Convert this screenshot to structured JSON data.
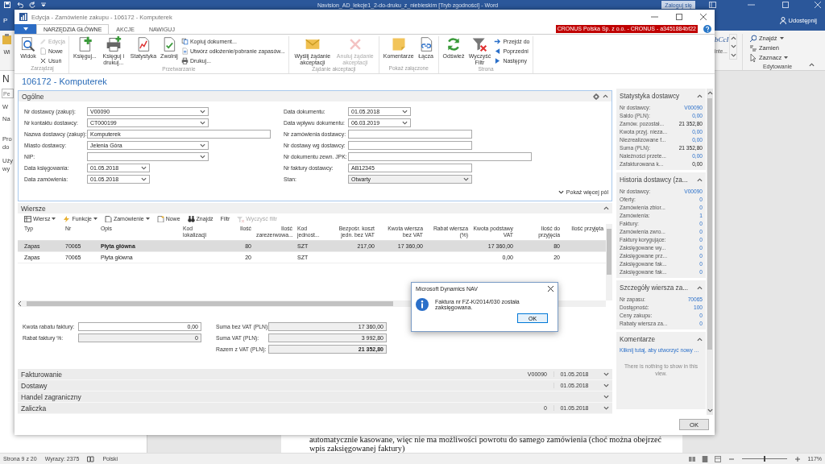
{
  "word": {
    "title": "Navision_AD_lekcje1_2-do-druku_z_niebieskim [Tryb zgodności] - Word",
    "sign_in": "Zaloguj się",
    "tab_fragment": "P",
    "share": "Udostępnij",
    "ribbon_fragment": "Wi",
    "gallery_fragments": [
      "bCcI",
      "inte..."
    ],
    "editing": {
      "items": [
        {
          "label": "Znajdź",
          "menu": true
        },
        {
          "label": "Zamień",
          "menu": false
        },
        {
          "label": "Zaznacz",
          "menu": true
        }
      ],
      "label": "Edytowanie"
    },
    "nav_pane": [
      {
        "kind": "heading",
        "text": "N"
      },
      {
        "kind": "search",
        "placeholder": "Pe"
      },
      {
        "kind": "tab",
        "text": "W"
      },
      {
        "kind": "tab",
        "text": "Na"
      },
      {
        "kind": "text",
        "text": "Pro"
      },
      {
        "kind": "text",
        "text": "do"
      },
      {
        "kind": "gap_text",
        "text": "Uży"
      },
      {
        "kind": "text",
        "text": "wy"
      }
    ],
    "document_lines": [
      "automatycznie kasowane, więc nie ma możliwości powrotu do samego zamówienia (choć można obejrzeć",
      "wpis zaksięgowanej faktury)"
    ],
    "status_bar": {
      "items": [
        "Strona 9 z 20",
        "Wyrazy: 2375",
        "Polski"
      ],
      "zoom": {
        "level": 0.5,
        "reading": "117%"
      }
    }
  },
  "nav": {
    "title": "Edycja - Zamówienie zakupu - 106172 - Komputerek",
    "tabs": [
      {
        "label": "NARZĘDZIA GŁÓWNE",
        "selected": true
      },
      {
        "label": "AKCJE",
        "selected": false
      },
      {
        "label": "NAWIGUJ",
        "selected": false
      }
    ],
    "company": "CRONUS Polska Sp. z o.o. - CRONUS - a3451884bf22",
    "ribbon": [
      {
        "label": "Zarządzaj",
        "buttons": [
          {
            "label": "Widok",
            "kind": "large",
            "disabled": false
          },
          {
            "label": "Edycja",
            "kind": "small",
            "disabled": true
          },
          {
            "label": "Nowe",
            "kind": "small",
            "disabled": false
          },
          {
            "label": "Usuń",
            "kind": "small",
            "disabled": false
          }
        ]
      },
      {
        "label": "Przetwarzanie",
        "buttons": [
          {
            "label": "Księguj...",
            "kind": "large",
            "disabled": false
          },
          {
            "label": "Księguj i drukuj...",
            "kind": "large",
            "disabled": false
          },
          {
            "label": "Statystyka",
            "kind": "large",
            "disabled": false
          },
          {
            "label": "Zwolnij",
            "kind": "large",
            "disabled": false
          },
          {
            "label": "Kopiuj dokument...",
            "kind": "small",
            "disabled": false
          },
          {
            "label": "Utwórz odłożenie/pobranie zapasów...",
            "kind": "small",
            "disabled": false
          },
          {
            "label": "Drukuj...",
            "kind": "small",
            "disabled": false
          }
        ]
      },
      {
        "label": "Żądanie akceptacji",
        "buttons": [
          {
            "label": "Wyślij żądanie akceptacji",
            "kind": "large",
            "disabled": false
          },
          {
            "label": "Anuluj żądanie akceptacji",
            "kind": "large",
            "disabled": true
          }
        ]
      },
      {
        "label": "Pokaż załączone",
        "buttons": [
          {
            "label": "Komentarze",
            "kind": "large",
            "disabled": false
          },
          {
            "label": "Łącza",
            "kind": "large",
            "disabled": false
          }
        ]
      },
      {
        "label": "Strona",
        "buttons": [
          {
            "label": "Odśwież",
            "kind": "large",
            "disabled": false
          },
          {
            "label": "Wyczyść Filtr",
            "kind": "large",
            "disabled": false
          },
          {
            "label": "Przejdź do",
            "kind": "small",
            "disabled": false
          },
          {
            "label": "Poprzedni",
            "kind": "small",
            "disabled": false
          },
          {
            "label": "Następny",
            "kind": "small",
            "disabled": false
          }
        ]
      }
    ],
    "page_title": "106172 - Komputerek",
    "general": {
      "title": "Ogólne",
      "left": [
        {
          "label": "Nr dostawcy (zakup):",
          "value": "V00090",
          "kind": "dropdown"
        },
        {
          "label": "Nr kontaktu dostawcy:",
          "value": "CT000199",
          "kind": "dropdown"
        },
        {
          "label": "Nazwa dostawcy (zakup):",
          "value": "Komputerek",
          "kind": "wide_text"
        },
        {
          "label": "Miasto dostawcy:",
          "value": "Jelenia Góra",
          "kind": "dropdown"
        },
        {
          "label": "NIP:",
          "kind": "dropdown"
        },
        {
          "label": "Data księgowania:",
          "value": "01.05.2018",
          "kind": "date"
        },
        {
          "label": "Data zamówienia:",
          "value": "01.05.2018",
          "kind": "date"
        }
      ],
      "right": [
        {
          "label": "Data dokumentu:",
          "value": "01.05.2018",
          "kind": "date"
        },
        {
          "label": "Data wpływu dokumentu:",
          "value": "06.03.2019",
          "kind": "date"
        },
        {
          "label": "Nr zamówienia dostawcy:",
          "kind": "text"
        },
        {
          "label": "Nr dostawy wg dostawcy:",
          "kind": "text"
        },
        {
          "label": "Nr dokumentu zewn. JPK:",
          "kind": "wide_text"
        },
        {
          "label": "Nr faktury dostawcy:",
          "value": "AB12345",
          "kind": "text"
        },
        {
          "label": "Stan:",
          "value": "Otwarty",
          "kind": "readonly_dropdown"
        }
      ],
      "more": "Pokaż więcej pól"
    },
    "lines": {
      "title": "Wiersze",
      "toolbar": [
        {
          "label": "Wiersz",
          "menu": true,
          "disabled": false
        },
        {
          "label": "Funkcje",
          "menu": true,
          "disabled": false
        },
        {
          "label": "Zamówienie",
          "menu": true,
          "disabled": false
        },
        {
          "label": "Nowe",
          "menu": false,
          "disabled": false
        },
        {
          "label": "Znajdź",
          "menu": false,
          "disabled": false
        },
        {
          "label": "Filtr",
          "menu": false,
          "disabled": false
        },
        {
          "label": "Wyczyść filtr",
          "menu": false,
          "disabled": true
        }
      ],
      "columns": [
        "Typ",
        "Nr",
        "Opis",
        "Kod lokalizacji",
        "Ilość",
        "Ilość zarezerwowa...",
        "Kod jednost...",
        "Bezpośr. koszt jedn. bez VAT",
        "Kwota wiersza bez VAT",
        "Rabat wiersza (%)",
        "Kwota podstawy VAT",
        "Ilość do przyjęcia",
        "Ilość przyjęta"
      ],
      "rows": [
        {
          "selected": true,
          "cells": [
            "Zapas",
            "70065",
            "Płyta główna",
            null,
            "80",
            null,
            "SZT",
            "217,00",
            "17 360,00",
            null,
            "17 360,00",
            "80",
            null
          ]
        },
        {
          "selected": false,
          "cells": [
            "Zapas",
            "70065",
            "Płyta główna",
            null,
            "20",
            null,
            "SZT",
            null,
            null,
            null,
            "0,00",
            "20",
            null
          ]
        }
      ]
    },
    "totals": {
      "left": [
        {
          "label": "Kwota rabatu faktury:",
          "value": "0,00",
          "editable": true
        },
        {
          "label": "Rabat faktury %:",
          "value": "0",
          "editable": false
        }
      ],
      "right": [
        {
          "label": "Suma bez VAT (PLN):",
          "value": "17 360,00"
        },
        {
          "label": "Suma VAT (PLN):",
          "value": "3 992,80"
        },
        {
          "label": "Razem z VAT (PLN):",
          "value": "21 352,80"
        }
      ]
    },
    "fasttabs": [
      {
        "title": "Fakturowanie",
        "summary": "V00090",
        "date": "01.05.2018"
      },
      {
        "title": "Dostawy",
        "date": "01.05.2018"
      },
      {
        "title": "Handel zagraniczny"
      },
      {
        "title": "Zaliczka",
        "summary": "0",
        "date": "01.05.2018"
      }
    ],
    "factbox": [
      {
        "title": "Statystyka dostawcy",
        "rows": [
          {
            "label": "Nr dostawcy:",
            "value": "V00090",
            "link": true
          },
          {
            "label": "Saldo (PLN):",
            "value": "0,00",
            "link": true
          },
          {
            "label": "Zamów. pozostał...",
            "value": "21 352,80",
            "link": false
          },
          {
            "label": "Kwota przyj. nieza...",
            "value": "0,00",
            "link": true
          },
          {
            "label": "Niezrealizowane f...",
            "value": "0,00",
            "link": true
          },
          {
            "label": "Suma (PLN):",
            "value": "21 352,80",
            "link": false
          },
          {
            "label": "Należności przete...",
            "value": "0,00",
            "link": true
          },
          {
            "label": "Zafakturowana k...",
            "value": "0,00",
            "link": false
          }
        ]
      },
      {
        "title": "Historia dostawcy (za...",
        "rows": [
          {
            "label": "Nr dostawcy:",
            "value": "V00090",
            "link": true
          },
          {
            "label": "Oferty:",
            "value": "0",
            "link": true
          },
          {
            "label": "Zamówienia zbior...",
            "value": "0",
            "link": true
          },
          {
            "label": "Zamówienia:",
            "value": "1",
            "link": true
          },
          {
            "label": "Faktury:",
            "value": "0",
            "link": true
          },
          {
            "label": "Zamówienia zwro...",
            "value": "0",
            "link": true
          },
          {
            "label": "Faktury korygujące:",
            "value": "0",
            "link": true
          },
          {
            "label": "Zaksięgowane wy...",
            "value": "0",
            "link": true
          },
          {
            "label": "Zaksięgowane prz...",
            "value": "0",
            "link": true
          },
          {
            "label": "Zaksięgowane fak...",
            "value": "0",
            "link": true
          },
          {
            "label": "Zaksięgowane fak...",
            "value": "0",
            "link": true
          }
        ]
      },
      {
        "title": "Szczegóły wiersza za...",
        "rows": [
          {
            "label": "Nr zapasu:",
            "value": "70065",
            "link": true
          },
          {
            "label": "Dostępność:",
            "value": "100",
            "link": true
          },
          {
            "label": "Ceny zakupu:",
            "value": "0",
            "link": true
          },
          {
            "label": "Rabaty wiersza za...",
            "value": "0",
            "link": true
          }
        ]
      }
    ],
    "comments": {
      "title": "Komentarze",
      "link": "Kliknij tutaj, aby utworzyć nowy ...",
      "empty": "There is nothing to show in this view."
    },
    "ok": "OK"
  },
  "dialog": {
    "title": "Microsoft Dynamics NAV",
    "message": "Faktura nr FZ-K/2014/030 została zaksięgowana.",
    "button": "OK"
  }
}
